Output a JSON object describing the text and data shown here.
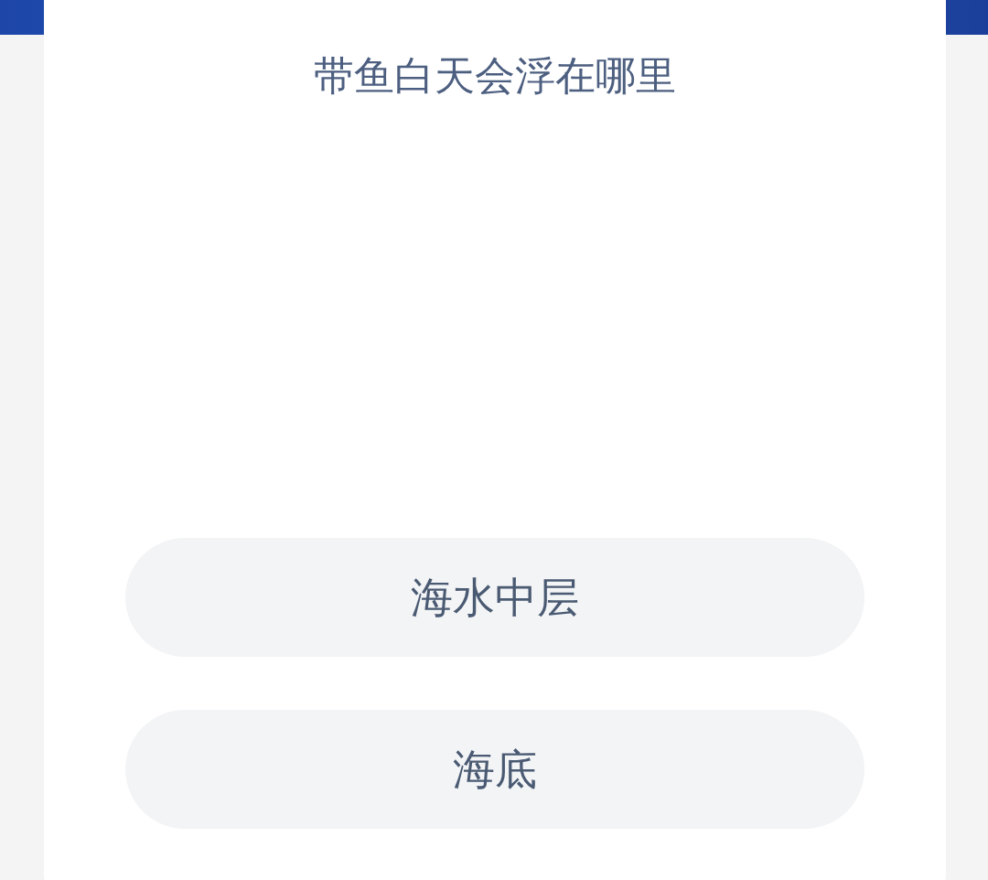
{
  "question": "带鱼白天会浮在哪里",
  "options": [
    {
      "label": "海水中层"
    },
    {
      "label": "海底"
    }
  ]
}
